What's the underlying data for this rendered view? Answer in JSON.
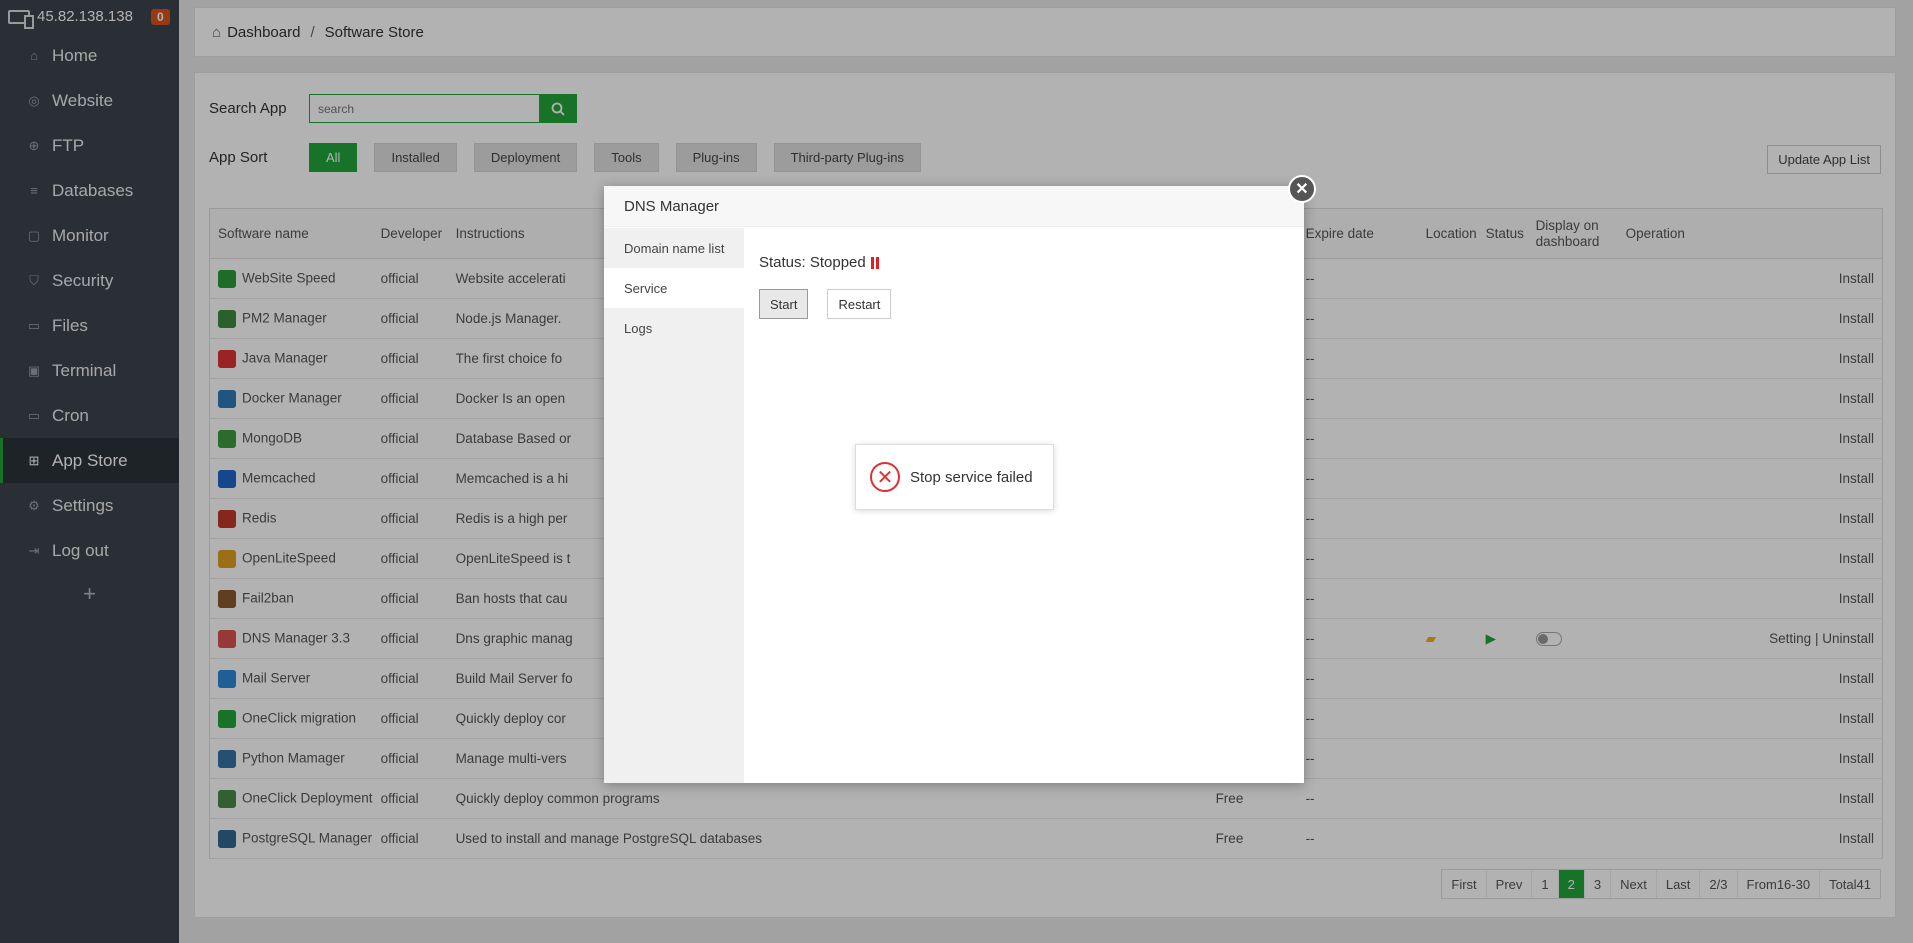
{
  "sidebar": {
    "server_ip": "45.82.138.138",
    "badge_count": "0",
    "items": [
      {
        "label": "Home",
        "icon": "home-icon"
      },
      {
        "label": "Website",
        "icon": "globe-icon"
      },
      {
        "label": "FTP",
        "icon": "ftp-icon"
      },
      {
        "label": "Databases",
        "icon": "database-icon"
      },
      {
        "label": "Monitor",
        "icon": "monitor-icon"
      },
      {
        "label": "Security",
        "icon": "shield-icon"
      },
      {
        "label": "Files",
        "icon": "folder-icon"
      },
      {
        "label": "Terminal",
        "icon": "terminal-icon"
      },
      {
        "label": "Cron",
        "icon": "cron-icon"
      },
      {
        "label": "App Store",
        "icon": "grid-icon"
      },
      {
        "label": "Settings",
        "icon": "gear-icon"
      },
      {
        "label": "Log out",
        "icon": "logout-icon"
      }
    ],
    "add_label": "+"
  },
  "breadcrumb": {
    "home": "Dashboard",
    "separator": "/",
    "current": "Software Store"
  },
  "search": {
    "label": "Search App",
    "placeholder": "search"
  },
  "sort": {
    "label": "App Sort",
    "buttons": [
      "All",
      "Installed",
      "Deployment",
      "Tools",
      "Plug-ins",
      "Third-party Plug-ins"
    ]
  },
  "update_button": "Update App List",
  "table": {
    "headers": {
      "name": "Software name",
      "developer": "Developer",
      "instructions": "Instructions",
      "price": "",
      "expire": "Expire date",
      "location": "Location",
      "status": "Status",
      "display": "Display on dashboard",
      "operation": "Operation"
    },
    "rows": [
      {
        "name": "WebSite Speed",
        "developer": "official",
        "instructions": "Website accelerati",
        "price": "",
        "expire": "--",
        "op": "Install"
      },
      {
        "name": "PM2 Manager",
        "developer": "official",
        "instructions": "Node.js Manager.",
        "price": "",
        "expire": "--",
        "op": "Install"
      },
      {
        "name": "Java Manager",
        "developer": "official",
        "instructions": "The first choice fo",
        "price": "",
        "expire": "--",
        "op": "Install"
      },
      {
        "name": "Docker Manager",
        "developer": "official",
        "instructions": "Docker Is an open",
        "price": "",
        "expire": "--",
        "op": "Install"
      },
      {
        "name": "MongoDB",
        "developer": "official",
        "instructions": "Database Based or",
        "price": "",
        "expire": "--",
        "op": "Install"
      },
      {
        "name": "Memcached",
        "developer": "official",
        "instructions": "Memcached is a hi",
        "price": "",
        "expire": "--",
        "op": "Install"
      },
      {
        "name": "Redis",
        "developer": "official",
        "instructions": "Redis is a high per",
        "price": "",
        "expire": "--",
        "op": "Install"
      },
      {
        "name": "OpenLiteSpeed",
        "developer": "official",
        "instructions": "OpenLiteSpeed is t",
        "price": "",
        "expire": "--",
        "op": "Install"
      },
      {
        "name": "Fail2ban",
        "developer": "official",
        "instructions": "Ban hosts that cau",
        "price": "",
        "expire": "--",
        "op": "Install"
      },
      {
        "name": "DNS Manager 3.3",
        "developer": "official",
        "instructions": "Dns graphic manag",
        "price": "",
        "expire": "--",
        "op_setting": "Setting",
        "op_sep": "|",
        "op_uninstall": "Uninstall"
      },
      {
        "name": "Mail Server",
        "developer": "official",
        "instructions": "Build Mail Server fo",
        "price": "",
        "expire": "--",
        "op": "Install"
      },
      {
        "name": "OneClick migration",
        "developer": "official",
        "instructions": "Quickly deploy cor",
        "price": "",
        "expire": "--",
        "op": "Install"
      },
      {
        "name": "Python Mamager",
        "developer": "official",
        "instructions": "Manage multi-vers",
        "price": "",
        "expire": "--",
        "op": "Install"
      },
      {
        "name": "OneClick Deployment",
        "developer": "official",
        "instructions": "Quickly deploy common programs",
        "price": "Free",
        "expire": "--",
        "op": "Install"
      },
      {
        "name": "PostgreSQL Manager",
        "developer": "official",
        "instructions": "Used to install and manage PostgreSQL databases",
        "price": "Free",
        "expire": "--",
        "op": "Install"
      }
    ]
  },
  "pager": {
    "items": [
      "First",
      "Prev",
      "1",
      "2",
      "3",
      "Next",
      "Last",
      "2/3",
      "From16-30",
      "Total41"
    ],
    "current": "2"
  },
  "modal": {
    "title": "DNS Manager",
    "tabs": [
      "Domain name list",
      "Service",
      "Logs"
    ],
    "active_tab": "Service",
    "status_text": "Status: Stopped",
    "start_label": "Start",
    "restart_label": "Restart"
  },
  "toast": {
    "message": "Stop service failed"
  },
  "colors": {
    "accent": "#20a53a",
    "sidebar": "#3c444d",
    "error": "#e0302f"
  }
}
